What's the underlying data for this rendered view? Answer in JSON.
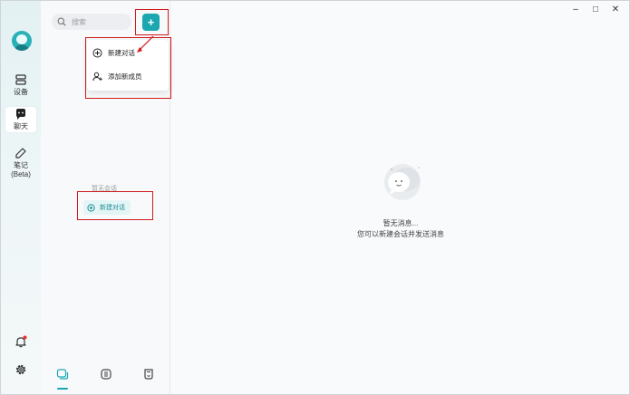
{
  "nav": {
    "items": [
      {
        "label": "设备"
      },
      {
        "label": "聊天"
      },
      {
        "label": "笔记\n(Beta)"
      }
    ]
  },
  "search": {
    "placeholder": "搜索"
  },
  "dropdown": {
    "items": [
      {
        "label": "新建对话",
        "icon": "plus-circle-icon"
      },
      {
        "label": "添加新成员",
        "icon": "add-user-icon"
      }
    ]
  },
  "list": {
    "empty_label": "暂无会话",
    "new_conversation_label": "新建对话"
  },
  "main": {
    "empty_title": "暂无消息...",
    "empty_subtitle": "您可以新建会话并发送消息"
  },
  "colors": {
    "accent": "#1aa7b0",
    "annotation": "#d0191b"
  }
}
